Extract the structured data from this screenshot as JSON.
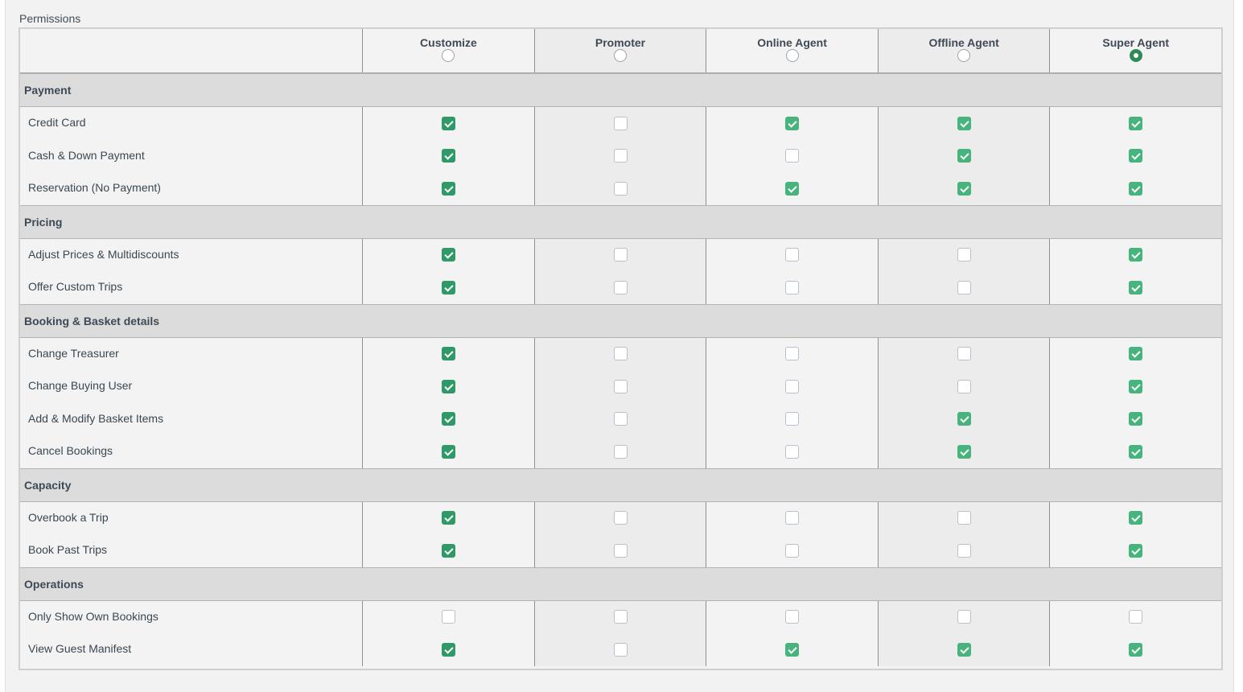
{
  "panel": {
    "title": "Permissions"
  },
  "roles": [
    {
      "name": "Customize",
      "selected": false
    },
    {
      "name": "Promoter",
      "selected": false
    },
    {
      "name": "Online Agent",
      "selected": false
    },
    {
      "name": "Offline Agent",
      "selected": false
    },
    {
      "name": "Super Agent",
      "selected": true
    }
  ],
  "sections": [
    {
      "title": "Payment",
      "permissions": [
        {
          "label": "Credit Card",
          "values": [
            true,
            false,
            true,
            true,
            true
          ]
        },
        {
          "label": "Cash & Down Payment",
          "values": [
            true,
            false,
            false,
            true,
            true
          ]
        },
        {
          "label": "Reservation (No Payment)",
          "values": [
            true,
            false,
            true,
            true,
            true
          ]
        }
      ]
    },
    {
      "title": "Pricing",
      "permissions": [
        {
          "label": "Adjust Prices & Multidiscounts",
          "values": [
            true,
            false,
            false,
            false,
            true
          ]
        },
        {
          "label": "Offer Custom Trips",
          "values": [
            true,
            false,
            false,
            false,
            true
          ]
        }
      ]
    },
    {
      "title": "Booking & Basket details",
      "permissions": [
        {
          "label": "Change Treasurer",
          "values": [
            true,
            false,
            false,
            false,
            true
          ]
        },
        {
          "label": "Change Buying User",
          "values": [
            true,
            false,
            false,
            false,
            true
          ]
        },
        {
          "label": "Add & Modify Basket Items",
          "values": [
            true,
            false,
            false,
            true,
            true
          ]
        },
        {
          "label": "Cancel Bookings",
          "values": [
            true,
            false,
            false,
            true,
            true
          ]
        }
      ]
    },
    {
      "title": "Capacity",
      "permissions": [
        {
          "label": "Overbook a Trip",
          "values": [
            true,
            false,
            false,
            false,
            true
          ]
        },
        {
          "label": "Book Past Trips",
          "values": [
            true,
            false,
            false,
            false,
            true
          ]
        }
      ]
    },
    {
      "title": "Operations",
      "permissions": [
        {
          "label": "Only Show Own Bookings",
          "values": [
            false,
            false,
            false,
            false,
            false
          ]
        },
        {
          "label": "View Guest Manifest",
          "values": [
            true,
            false,
            true,
            true,
            true
          ]
        }
      ]
    }
  ],
  "colors": {
    "checked_primary": "#2f9a68",
    "checked_light": "#46b47c",
    "section_bg": "#dcdcdc"
  }
}
